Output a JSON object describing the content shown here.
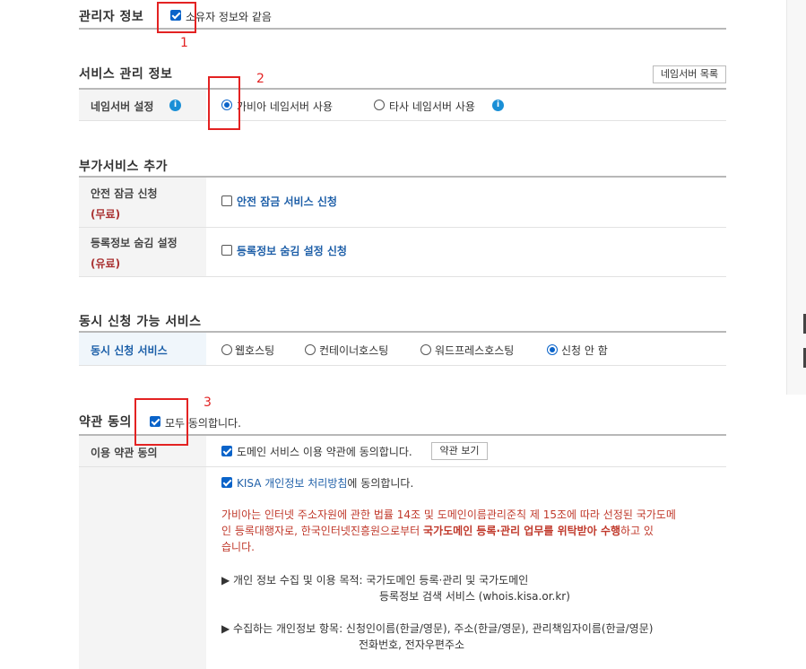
{
  "admin": {
    "title": "관리자 정보",
    "same_as_owner": "소유자 정보와 같음"
  },
  "service_admin": {
    "title": "서비스 관리 정보",
    "ns_list_button": "네임서버 목록",
    "ns_label": "네임서버 설정",
    "opt_gabia": "가비아 네임서버 사용",
    "opt_other": "타사 네임서버 사용"
  },
  "addon": {
    "title": "부가서비스 추가",
    "lock_label": "안전 잠금 신청",
    "lock_price": "(무료)",
    "lock_option": "안전 잠금 서비스 신청",
    "hide_label": "등록정보 숨김 설정",
    "hide_price": "(유료)",
    "hide_option": "등록정보 숨김 설정 신청"
  },
  "concurrent": {
    "title": "동시 신청 가능 서비스",
    "label": "동시 신청 서비스",
    "options": [
      "웹호스팅",
      "컨테이너호스팅",
      "워드프레스호스팅",
      "신청 안 함"
    ]
  },
  "terms": {
    "title": "약관 동의",
    "agree_all": "모두 동의합니다.",
    "usage_label": "이용 약관 동의",
    "agree_domain": "도메인 서비스 이용 약관에 동의합니다.",
    "view_terms_button": "약관 보기",
    "kisa_link": "KISA 개인정보 처리방침",
    "kisa_suffix": "에 동의합니다.",
    "notice_p1": "가비아는 인터넷 주소자원에 관한 법률 14조 및 도메인이름관리준칙 제 15조에 따라 선정된 국가도메",
    "notice_p2": "인 등록대행자로, 한국인터넷진흥원으로부터 ",
    "notice_bold": "국가도메인 등록·관리 업무를 위탁받아 수행",
    "notice_p3": "하고 있",
    "notice_p4": "습니다.",
    "purpose_1": "▶ 개인 정보 수집 및 이용 목적: 국가도메인 등록·관리 및 국가도메인",
    "purpose_2": "등록정보 검색 서비스 (whois.kisa.or.kr)",
    "items_1": "▶ 수집하는 개인정보 항목: 신청인이름(한글/영문), 주소(한글/영문), 관리책임자이름(한글/영문)",
    "items_2": "전화번호, 전자우편주소"
  },
  "annotations": [
    "1",
    "2",
    "3"
  ]
}
